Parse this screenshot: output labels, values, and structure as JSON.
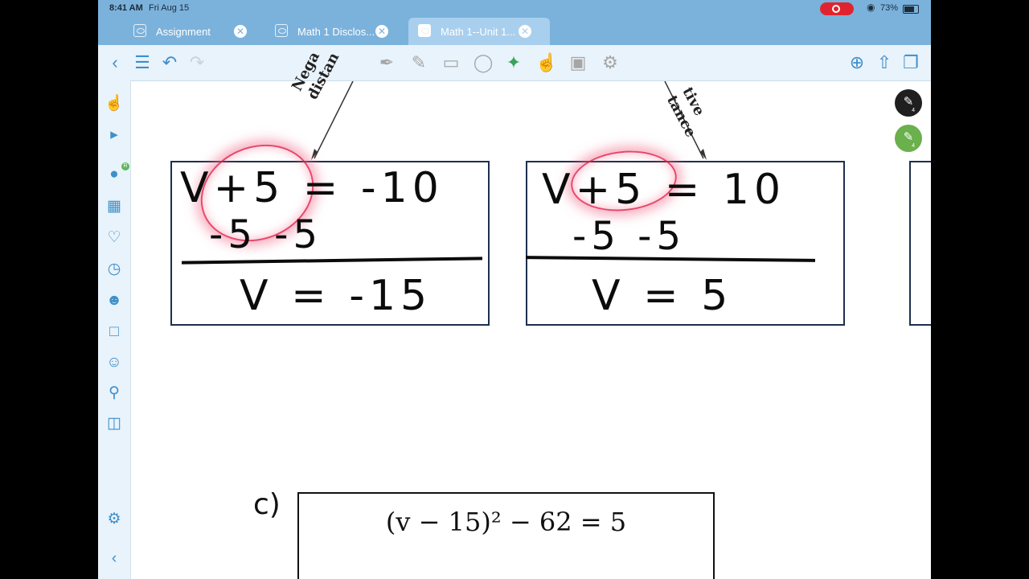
{
  "status_bar": {
    "time": "8:41 AM",
    "date": "Fri Aug 15",
    "battery": "73%"
  },
  "tabs": [
    {
      "label": "Assignment",
      "active": false
    },
    {
      "label": "Math 1 Disclos...",
      "active": false
    },
    {
      "label": "Math 1--Unit 1...",
      "active": true
    }
  ],
  "toolbar": {
    "left_icons": [
      "back-icon",
      "menu-icon",
      "undo-icon",
      "redo-icon"
    ],
    "tool_icons": [
      "pen-icon",
      "pencil-icon",
      "eraser-icon",
      "lasso-icon",
      "laser-pointer-icon",
      "hand-icon",
      "image-icon",
      "gear-icon"
    ],
    "right_icons": [
      "add-page-icon",
      "share-icon",
      "copy-icon"
    ]
  },
  "rail_icons": [
    "hand-icon",
    "ruler-icon",
    "microphone-icon",
    "calculator-icon",
    "bookmark-icon",
    "timer-icon",
    "collaborate-icon",
    "document-icon",
    "assistant-icon",
    "search-icon",
    "presentation-icon",
    "gear-icon",
    "collapse-icon"
  ],
  "rail_badge": "R",
  "pens": [
    {
      "color": "#1f1f1f",
      "size": "4"
    },
    {
      "color": "#6ab04c",
      "size": "4"
    }
  ],
  "worksheet": {
    "label_left": "Nega\ndistan",
    "label_right": "tive\ntance",
    "box1": {
      "line1": "V+5 = -10",
      "line2": "-5   -5",
      "line3": "V = -15"
    },
    "box2": {
      "line1": "V+5 = 10",
      "line2": "-5  -5",
      "line3": "V = 5"
    },
    "problem_label": "c)",
    "problem_c": "(v − 15)² − 62 = 5"
  }
}
